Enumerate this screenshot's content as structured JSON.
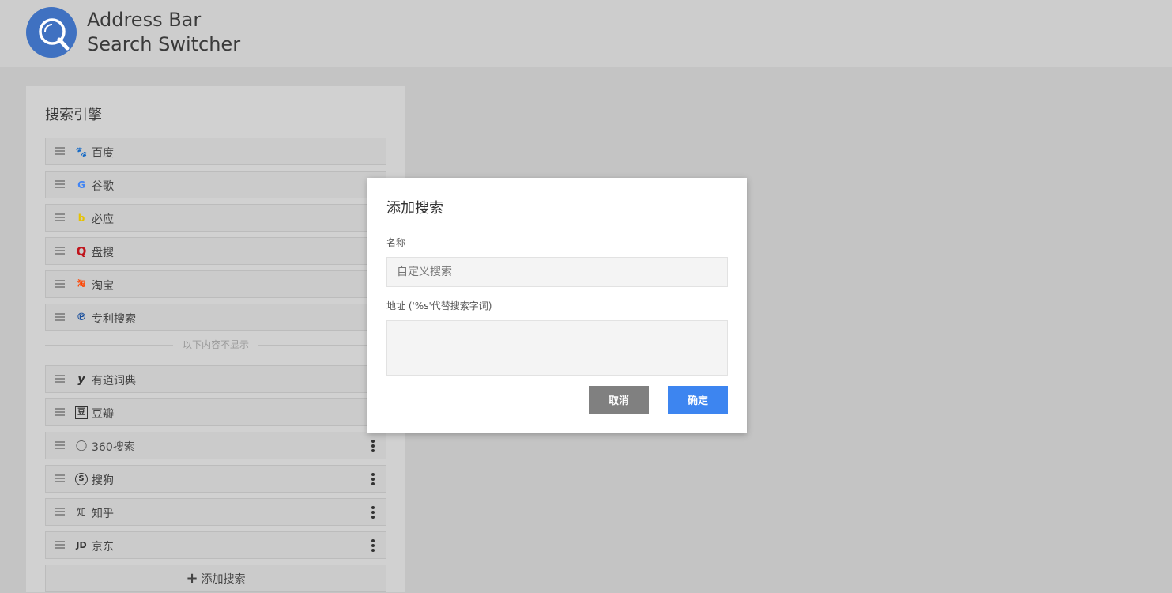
{
  "app": {
    "title_line1": "Address Bar",
    "title_line2": "Search Switcher",
    "brand_color": "#3f71c1"
  },
  "panel": {
    "title": "搜索引擎",
    "visible_engines": [
      {
        "label": "百度",
        "icon": "baidu-paw-icon",
        "glyph": "🐾"
      },
      {
        "label": "谷歌",
        "icon": "google-g-icon",
        "glyph": "G"
      },
      {
        "label": "必应",
        "icon": "bing-b-icon",
        "glyph": "b"
      },
      {
        "label": "盘搜",
        "icon": "pansou-q-icon",
        "glyph": "Q"
      },
      {
        "label": "淘宝",
        "icon": "taobao-icon",
        "glyph": "淘"
      },
      {
        "label": "专利搜索",
        "icon": "patent-icon",
        "glyph": "℗"
      }
    ],
    "divider_text": "以下内容不显示",
    "hidden_engines": [
      {
        "label": "有道词典",
        "icon": "youdao-y-icon",
        "glyph": "y"
      },
      {
        "label": "豆瓣",
        "icon": "douban-icon",
        "glyph": "豆"
      },
      {
        "label": "360搜索",
        "icon": "360-ring-icon",
        "glyph": "◯"
      },
      {
        "label": "搜狗",
        "icon": "sogou-s-icon",
        "glyph": "S"
      },
      {
        "label": "知乎",
        "icon": "zhihu-icon",
        "glyph": "知"
      },
      {
        "label": "京东",
        "icon": "jd-icon",
        "glyph": "JD"
      }
    ],
    "add_button": "添加搜索",
    "add_icon": "+"
  },
  "dialog": {
    "title": "添加搜索",
    "name_label": "名称",
    "name_placeholder": "自定义搜索",
    "url_label": "地址 ('%s'代替搜索字词)",
    "url_value": "",
    "cancel_label": "取消",
    "confirm_label": "确定",
    "cancel_color": "#808080",
    "confirm_color": "#3d85f0"
  }
}
